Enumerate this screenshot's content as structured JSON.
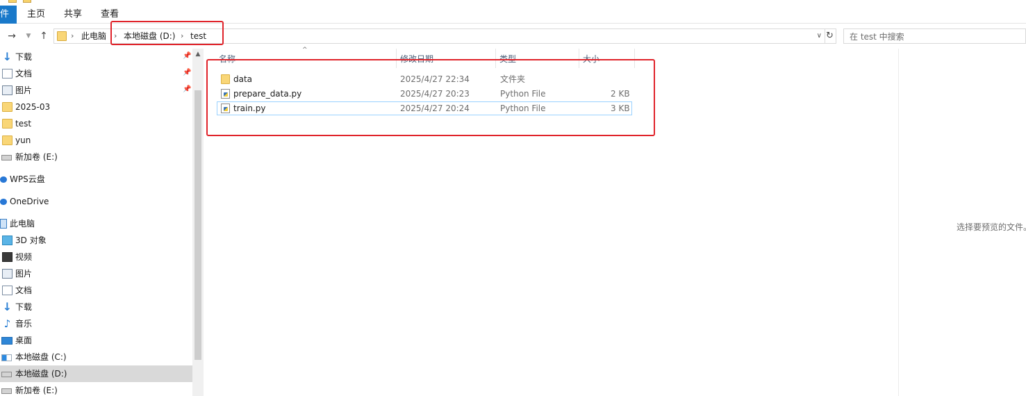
{
  "ribbon": {
    "tabs": [
      {
        "label": "件"
      },
      {
        "label": "主页"
      },
      {
        "label": "共享"
      },
      {
        "label": "查看"
      }
    ]
  },
  "address": {
    "crumbs": [
      "此电脑",
      "本地磁盘 (D:)",
      "test"
    ]
  },
  "search": {
    "placeholder": "在 test 中搜索"
  },
  "nav": {
    "items": [
      {
        "label": "下载",
        "icon": "download-arrow-icon",
        "pinned": true
      },
      {
        "label": "文档",
        "icon": "document-icon",
        "pinned": true
      },
      {
        "label": "图片",
        "icon": "picture-icon",
        "pinned": true
      },
      {
        "label": "2025-03",
        "icon": "folder-icon"
      },
      {
        "label": "test",
        "icon": "folder-icon"
      },
      {
        "label": "yun",
        "icon": "folder-icon"
      },
      {
        "label": "新加卷 (E:)",
        "icon": "drive-icon"
      },
      {
        "label": "WPS云盘",
        "icon": "cloud-icon"
      },
      {
        "label": "OneDrive",
        "icon": "cloud-icon"
      },
      {
        "label": "此电脑",
        "icon": "computer-icon"
      },
      {
        "label": "3D 对象",
        "icon": "3d-objects-icon"
      },
      {
        "label": "视频",
        "icon": "video-icon"
      },
      {
        "label": "图片",
        "icon": "picture-icon"
      },
      {
        "label": "文档",
        "icon": "document-icon"
      },
      {
        "label": "下载",
        "icon": "download-arrow-icon"
      },
      {
        "label": "音乐",
        "icon": "music-note-icon"
      },
      {
        "label": "桌面",
        "icon": "desktop-icon"
      },
      {
        "label": "本地磁盘 (C:)",
        "icon": "windows-drive-icon"
      },
      {
        "label": "本地磁盘 (D:)",
        "icon": "drive-icon",
        "selected": true
      },
      {
        "label": "新加卷 (E:)",
        "icon": "drive-icon"
      }
    ]
  },
  "columns": {
    "name": "名称",
    "modified": "修改日期",
    "type": "类型",
    "size": "大小"
  },
  "files": [
    {
      "name": "data",
      "modified": "2025/4/27 22:34",
      "type": "文件夹",
      "size": "",
      "icon": "folder-icon"
    },
    {
      "name": "prepare_data.py",
      "modified": "2025/4/27 20:23",
      "type": "Python File",
      "size": "2 KB",
      "icon": "python-file-icon"
    },
    {
      "name": "train.py",
      "modified": "2025/4/27 20:24",
      "type": "Python File",
      "size": "3 KB",
      "icon": "python-file-icon"
    }
  ],
  "preview": {
    "message": "选择要预览的文件。"
  },
  "colors": {
    "accent": "#1979ca",
    "highlight_box": "#e0232a",
    "selection": "#d9d9d9"
  }
}
